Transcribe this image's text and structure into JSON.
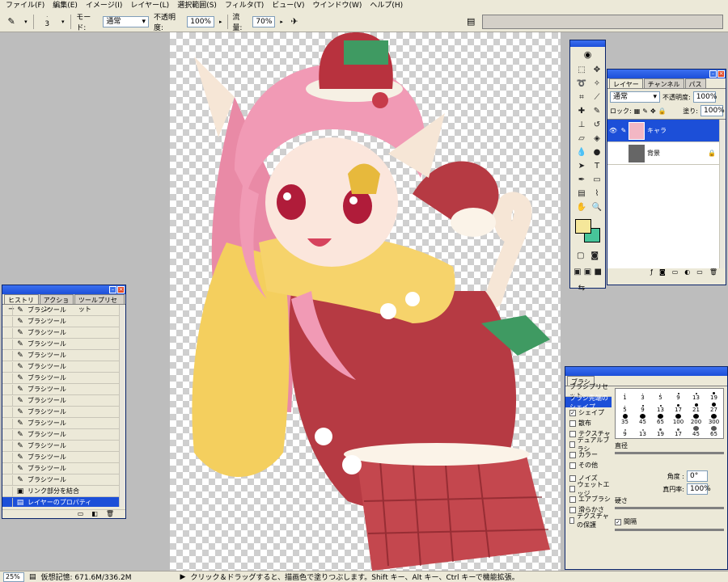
{
  "menu": [
    "ファイル(F)",
    "編集(E)",
    "イメージ(I)",
    "レイヤー(L)",
    "選択範囲(S)",
    "フィルタ(T)",
    "ビュー(V)",
    "ウインドウ(W)",
    "ヘルプ(H)"
  ],
  "options": {
    "brush_size": "3",
    "mode_label": "モード:",
    "mode_value": "通常",
    "opacity_label": "不透明度:",
    "opacity_value": "100%",
    "flow_label": "流量:",
    "flow_value": "70%"
  },
  "status": {
    "zoom": "25%",
    "doc_label": "仮想記憶: 671.6M/336.2M",
    "hint": "クリック＆ドラッグすると、描画色で塗りつぶします。Shift キー、Alt キー、Ctrl キーで機能拡張。"
  },
  "history": {
    "tabs": [
      "ヒストリー",
      "アクション",
      "ツールプリセット"
    ],
    "items": [
      "ブラシツール",
      "ブラシツール",
      "ブラシツール",
      "ブラシツール",
      "ブラシツール",
      "ブラシツール",
      "ブラシツール",
      "ブラシツール",
      "ブラシツール",
      "ブラシツール",
      "ブラシツール",
      "ブラシツール",
      "ブラシツール",
      "ブラシツール",
      "ブラシツール",
      "ブラシツール"
    ],
    "merge_item": "リンク部分を結合",
    "selected_item": "レイヤーのプロパティ"
  },
  "layers": {
    "tabs": [
      "レイヤー",
      "チャンネル",
      "パス"
    ],
    "blend_mode": "通常",
    "opacity_label": "不透明度:",
    "opacity_value": "100%",
    "lock_label": "ロック:",
    "fill_label": "塗り:",
    "fill_value": "100%",
    "items": [
      {
        "name": "キャラ",
        "selected": true
      },
      {
        "name": "背景",
        "selected": false
      }
    ]
  },
  "brushes": {
    "tab": "ブラシ",
    "presets_label": "ブラシプリセット",
    "tip_shape_label": "ブラシ先端のシェイプ",
    "options": [
      {
        "label": "シェイプ",
        "checked": true
      },
      {
        "label": "散布",
        "checked": false
      },
      {
        "label": "テクスチャ",
        "checked": false
      },
      {
        "label": "デュアルブラシ",
        "checked": false
      },
      {
        "label": "カラー",
        "checked": false
      },
      {
        "label": "その他",
        "checked": false
      },
      {
        "label": "ノイズ",
        "checked": false
      },
      {
        "label": "ウェットエッジ",
        "checked": false
      },
      {
        "label": "エアブラシ",
        "checked": false
      },
      {
        "label": "滑らかさ",
        "checked": false
      },
      {
        "label": "テクスチャの保護",
        "checked": false
      }
    ],
    "grid_sizes": [
      "1",
      "3",
      "5",
      "9",
      "13",
      "19",
      "5",
      "9",
      "13",
      "17",
      "21",
      "27",
      "35",
      "45",
      "65",
      "100",
      "200",
      "300",
      "9",
      "13",
      "19",
      "17",
      "45",
      "65"
    ],
    "diameter_label": "直径",
    "angle_label": "角度 :",
    "angle_value": "0°",
    "roundness_label": "真円率:",
    "roundness_value": "100%",
    "hardness_label": "硬さ",
    "spacing_label": "間隔",
    "spacing_checked": true
  },
  "colors": {
    "foreground": "#f5e79a",
    "background": "#47c59a",
    "selection": "#1c4fd8"
  }
}
